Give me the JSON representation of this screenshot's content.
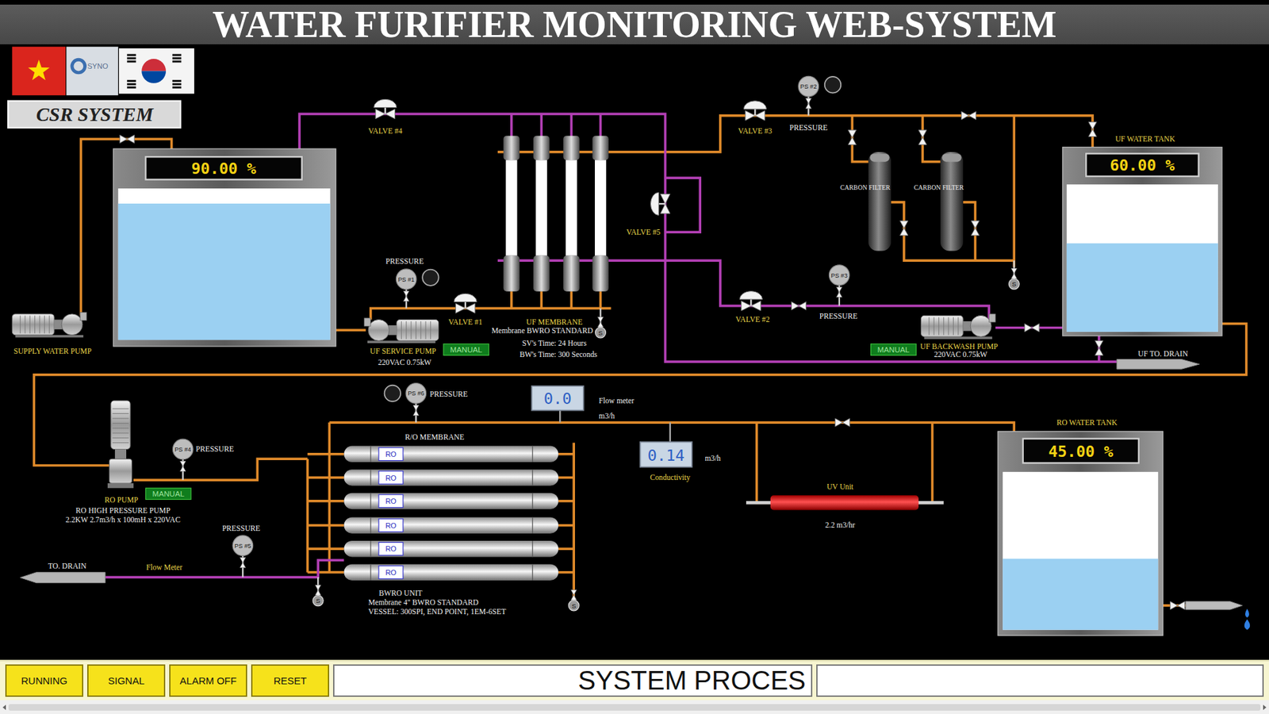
{
  "header": {
    "title": "WATER FURIFIER MONITORING WEB-SYSTEM",
    "logo_text": "SYNO",
    "system_badge": "CSR SYSTEM"
  },
  "tanks": [
    {
      "reading": "90.00 %",
      "level": 0.9
    },
    {
      "label": "UF WATER TANK",
      "reading": "60.00 %",
      "level": 0.6
    },
    {
      "label": "RO WATER TANK",
      "reading": "45.00 %",
      "level": 0.45
    }
  ],
  "pumps": [
    {
      "kind": "horizontal",
      "label": "SUPPLY WATER PUMP",
      "specs": []
    },
    {
      "kind": "horizontal",
      "label": "UF SERVICE PUMP",
      "specs": [
        "220VAC 0.75kW"
      ],
      "mode": "MANUAL"
    },
    {
      "kind": "horizontal",
      "label": "UF BACKWASH PUMP",
      "specs": [
        "220VAC 0.75kW"
      ],
      "mode": "MANUAL"
    },
    {
      "kind": "vertical",
      "label": "RO PUMP",
      "specs": [
        "RO HIGH PRESSURE PUMP",
        "2.2KW 2.7m3/h x 100mH x 220VAC"
      ],
      "mode": "MANUAL"
    }
  ],
  "valves": [
    {
      "label": "VALVE #4"
    },
    {
      "label": "VALVE #3"
    },
    {
      "label": "VALVE #5"
    },
    {
      "label": "VALVE #1"
    },
    {
      "label": "VALVE #2"
    }
  ],
  "pressure_sensors": [
    {
      "tag": "PS #1",
      "label": "PRESSURE"
    },
    {
      "tag": "PS #2",
      "label": "PRESSURE"
    },
    {
      "tag": "PS #3",
      "label": "PRESSURE"
    },
    {
      "tag": "PS #4",
      "label": "PRESSURE"
    },
    {
      "tag": "PS #5",
      "label": "PRESSURE"
    },
    {
      "tag": "PS #6",
      "label": "PRESSURE"
    }
  ],
  "carbon_filters": [
    {
      "label": "CARBON FILTER"
    },
    {
      "label": "CARBON FILTER"
    }
  ],
  "uf_membrane": {
    "title": "UF MEMBRANE",
    "model": "Membrane BWRO STANDARD",
    "sv_time": "SV's Time: 24 Hours",
    "bw_time": "BW's Time: 300 Seconds"
  },
  "ro_membrane": {
    "title": "R/O MEMBRANE",
    "elements": [
      "RO",
      "RO",
      "RO",
      "RO",
      "RO",
      "RO"
    ],
    "unit": "BWRO UNIT",
    "model": "Membrane 4\" BWRO STANDARD",
    "vessel": "VESSEL: 300SPI, END POINT, 1EM-6SET"
  },
  "flow_meter": {
    "reading": "0.0",
    "label": "Flow meter",
    "unit": "m3/h"
  },
  "conductivity": {
    "reading": "0.14",
    "unit": "m3/h",
    "label": "Conductivity"
  },
  "uv_unit": {
    "label": "UV Unit",
    "rating": "2.2 m3/hr"
  },
  "drains": [
    {
      "label": "UF TO. DRAIN"
    },
    {
      "label": "TO. DRAIN"
    }
  ],
  "drain_flow_meter": {
    "label": "Flow Meter"
  },
  "sample_points": [
    "S",
    "S",
    "S",
    "S"
  ],
  "buttons": [
    {
      "label": "RUNNING"
    },
    {
      "label": "SIGNAL"
    },
    {
      "label": "ALARM OFF"
    },
    {
      "label": "RESET"
    }
  ],
  "status_bar": {
    "text": "SYSTEM PROCES"
  }
}
